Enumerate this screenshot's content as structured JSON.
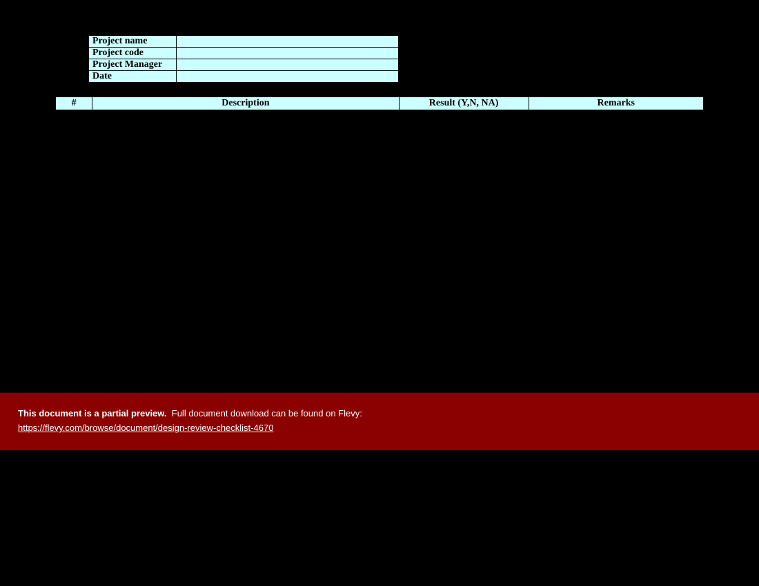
{
  "info": {
    "rows": [
      {
        "label": "Project name",
        "value": ""
      },
      {
        "label": "Project code",
        "value": ""
      },
      {
        "label": "Project Manager",
        "value": ""
      },
      {
        "label": "Date",
        "value": ""
      }
    ]
  },
  "checklist": {
    "columns": {
      "num": "#",
      "description": "Description",
      "result": "Result (Y,N, NA)",
      "remarks": "Remarks"
    }
  },
  "banner": {
    "strong": "This document is a partial preview.",
    "text": "Full document download can be found on Flevy:",
    "link": "https://flevy.com/browse/document/design-review-checklist-4670"
  }
}
